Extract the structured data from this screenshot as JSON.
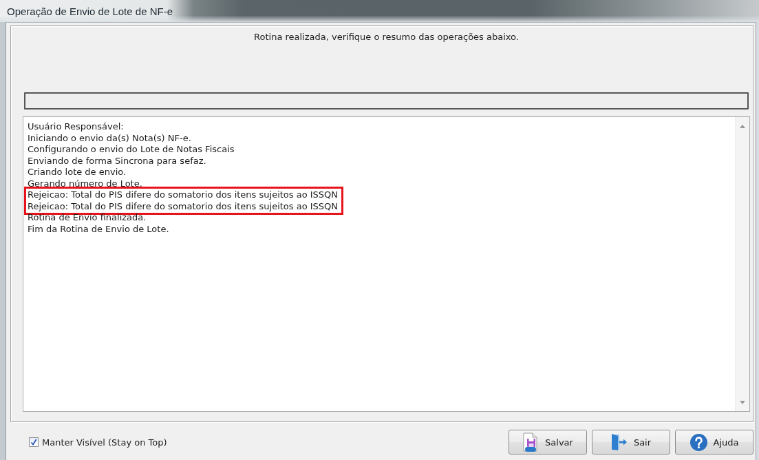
{
  "window": {
    "title": "Operação de Envio de Lote de NF-e"
  },
  "message": "Rotina realizada, verifique o resumo das operações abaixo.",
  "progress": {
    "level": 0
  },
  "log": {
    "entries": [
      {
        "text": "Usuário Responsável:",
        "highlighted": false
      },
      {
        "text": "Iniciando o envio da(s) Nota(s) NF-e.",
        "highlighted": false
      },
      {
        "text": "Configurando o envio do Lote de Notas Fiscais",
        "highlighted": false
      },
      {
        "text": "Enviando de forma Sincrona para sefaz.",
        "highlighted": false
      },
      {
        "text": "Criando lote de envio.",
        "highlighted": false
      },
      {
        "text": "Gerando número de Lote.",
        "highlighted": false
      },
      {
        "text": "Rejeicao: Total do PIS difere do somatorio dos itens sujeitos ao ISSQN",
        "highlighted": true
      },
      {
        "text": "Rejeicao: Total do PIS difere do somatorio dos itens sujeitos ao ISSQN",
        "highlighted": true
      },
      {
        "text": "Rotina de Envio finalizada.",
        "highlighted": false
      },
      {
        "text": "Fim da Rotina de Envio de Lote.",
        "highlighted": false
      }
    ]
  },
  "stay_on_top": {
    "label": "Manter Visível (Stay on Top)",
    "checked": true
  },
  "buttons": [
    {
      "label": "Salvar",
      "kind": "save"
    },
    {
      "label": "Sair",
      "kind": "exit"
    },
    {
      "label": "Ajuda",
      "kind": "help"
    }
  ]
}
